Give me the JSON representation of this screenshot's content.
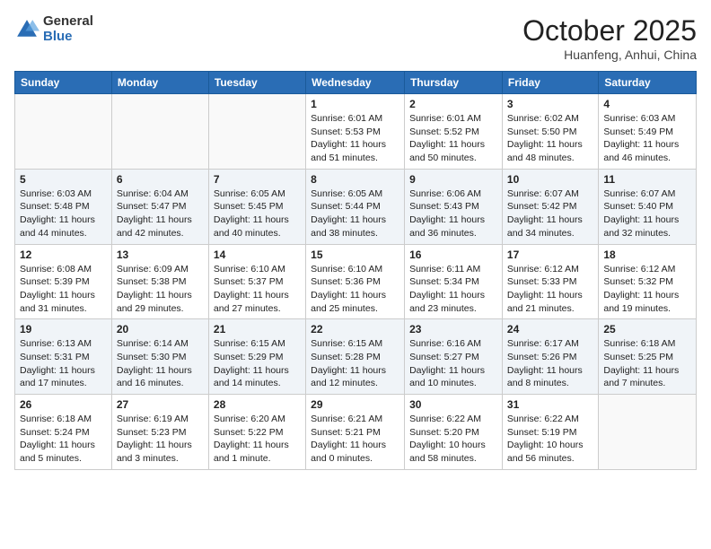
{
  "header": {
    "logo_general": "General",
    "logo_blue": "Blue",
    "month_title": "October 2025",
    "location": "Huanfeng, Anhui, China"
  },
  "calendar": {
    "days_of_week": [
      "Sunday",
      "Monday",
      "Tuesday",
      "Wednesday",
      "Thursday",
      "Friday",
      "Saturday"
    ],
    "weeks": [
      [
        {
          "day": "",
          "info": ""
        },
        {
          "day": "",
          "info": ""
        },
        {
          "day": "",
          "info": ""
        },
        {
          "day": "1",
          "info": "Sunrise: 6:01 AM\nSunset: 5:53 PM\nDaylight: 11 hours\nand 51 minutes."
        },
        {
          "day": "2",
          "info": "Sunrise: 6:01 AM\nSunset: 5:52 PM\nDaylight: 11 hours\nand 50 minutes."
        },
        {
          "day": "3",
          "info": "Sunrise: 6:02 AM\nSunset: 5:50 PM\nDaylight: 11 hours\nand 48 minutes."
        },
        {
          "day": "4",
          "info": "Sunrise: 6:03 AM\nSunset: 5:49 PM\nDaylight: 11 hours\nand 46 minutes."
        }
      ],
      [
        {
          "day": "5",
          "info": "Sunrise: 6:03 AM\nSunset: 5:48 PM\nDaylight: 11 hours\nand 44 minutes."
        },
        {
          "day": "6",
          "info": "Sunrise: 6:04 AM\nSunset: 5:47 PM\nDaylight: 11 hours\nand 42 minutes."
        },
        {
          "day": "7",
          "info": "Sunrise: 6:05 AM\nSunset: 5:45 PM\nDaylight: 11 hours\nand 40 minutes."
        },
        {
          "day": "8",
          "info": "Sunrise: 6:05 AM\nSunset: 5:44 PM\nDaylight: 11 hours\nand 38 minutes."
        },
        {
          "day": "9",
          "info": "Sunrise: 6:06 AM\nSunset: 5:43 PM\nDaylight: 11 hours\nand 36 minutes."
        },
        {
          "day": "10",
          "info": "Sunrise: 6:07 AM\nSunset: 5:42 PM\nDaylight: 11 hours\nand 34 minutes."
        },
        {
          "day": "11",
          "info": "Sunrise: 6:07 AM\nSunset: 5:40 PM\nDaylight: 11 hours\nand 32 minutes."
        }
      ],
      [
        {
          "day": "12",
          "info": "Sunrise: 6:08 AM\nSunset: 5:39 PM\nDaylight: 11 hours\nand 31 minutes."
        },
        {
          "day": "13",
          "info": "Sunrise: 6:09 AM\nSunset: 5:38 PM\nDaylight: 11 hours\nand 29 minutes."
        },
        {
          "day": "14",
          "info": "Sunrise: 6:10 AM\nSunset: 5:37 PM\nDaylight: 11 hours\nand 27 minutes."
        },
        {
          "day": "15",
          "info": "Sunrise: 6:10 AM\nSunset: 5:36 PM\nDaylight: 11 hours\nand 25 minutes."
        },
        {
          "day": "16",
          "info": "Sunrise: 6:11 AM\nSunset: 5:34 PM\nDaylight: 11 hours\nand 23 minutes."
        },
        {
          "day": "17",
          "info": "Sunrise: 6:12 AM\nSunset: 5:33 PM\nDaylight: 11 hours\nand 21 minutes."
        },
        {
          "day": "18",
          "info": "Sunrise: 6:12 AM\nSunset: 5:32 PM\nDaylight: 11 hours\nand 19 minutes."
        }
      ],
      [
        {
          "day": "19",
          "info": "Sunrise: 6:13 AM\nSunset: 5:31 PM\nDaylight: 11 hours\nand 17 minutes."
        },
        {
          "day": "20",
          "info": "Sunrise: 6:14 AM\nSunset: 5:30 PM\nDaylight: 11 hours\nand 16 minutes."
        },
        {
          "day": "21",
          "info": "Sunrise: 6:15 AM\nSunset: 5:29 PM\nDaylight: 11 hours\nand 14 minutes."
        },
        {
          "day": "22",
          "info": "Sunrise: 6:15 AM\nSunset: 5:28 PM\nDaylight: 11 hours\nand 12 minutes."
        },
        {
          "day": "23",
          "info": "Sunrise: 6:16 AM\nSunset: 5:27 PM\nDaylight: 11 hours\nand 10 minutes."
        },
        {
          "day": "24",
          "info": "Sunrise: 6:17 AM\nSunset: 5:26 PM\nDaylight: 11 hours\nand 8 minutes."
        },
        {
          "day": "25",
          "info": "Sunrise: 6:18 AM\nSunset: 5:25 PM\nDaylight: 11 hours\nand 7 minutes."
        }
      ],
      [
        {
          "day": "26",
          "info": "Sunrise: 6:18 AM\nSunset: 5:24 PM\nDaylight: 11 hours\nand 5 minutes."
        },
        {
          "day": "27",
          "info": "Sunrise: 6:19 AM\nSunset: 5:23 PM\nDaylight: 11 hours\nand 3 minutes."
        },
        {
          "day": "28",
          "info": "Sunrise: 6:20 AM\nSunset: 5:22 PM\nDaylight: 11 hours\nand 1 minute."
        },
        {
          "day": "29",
          "info": "Sunrise: 6:21 AM\nSunset: 5:21 PM\nDaylight: 11 hours\nand 0 minutes."
        },
        {
          "day": "30",
          "info": "Sunrise: 6:22 AM\nSunset: 5:20 PM\nDaylight: 10 hours\nand 58 minutes."
        },
        {
          "day": "31",
          "info": "Sunrise: 6:22 AM\nSunset: 5:19 PM\nDaylight: 10 hours\nand 56 minutes."
        },
        {
          "day": "",
          "info": ""
        }
      ]
    ]
  }
}
